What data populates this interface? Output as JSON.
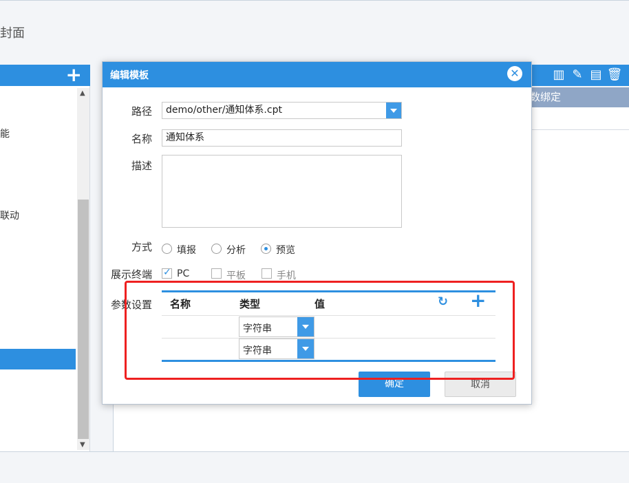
{
  "background": {
    "title": "封面",
    "left_items": [
      "能",
      "联动"
    ],
    "right_subheader": "数绑定"
  },
  "toolbar_icons": [
    "chart-add-icon",
    "edit-link-icon",
    "table-edit-icon",
    "trash-icon"
  ],
  "dialog": {
    "title": "编辑模板",
    "path_label": "路径",
    "path_value": "demo/other/通知体系.cpt",
    "name_label": "名称",
    "name_value": "通知体系",
    "desc_label": "描述",
    "desc_value": "",
    "mode_label": "方式",
    "mode_options": [
      "填报",
      "分析",
      "预览"
    ],
    "mode_selected": "预览",
    "terminal_label": "展示终端",
    "terminal_options": [
      {
        "label": "PC",
        "checked": true
      },
      {
        "label": "平板",
        "checked": false
      },
      {
        "label": "手机",
        "checked": false
      }
    ],
    "params_label": "参数设置",
    "params_headers": {
      "name": "名称",
      "type": "类型",
      "value": "值"
    },
    "params_rows": [
      {
        "name": "",
        "type": "字符串",
        "value": ""
      },
      {
        "name": "",
        "type": "字符串",
        "value": ""
      }
    ],
    "ok_label": "确定",
    "cancel_label": "取消"
  },
  "colors": {
    "accent": "#2d8fe0",
    "highlight": "#ee2020"
  }
}
